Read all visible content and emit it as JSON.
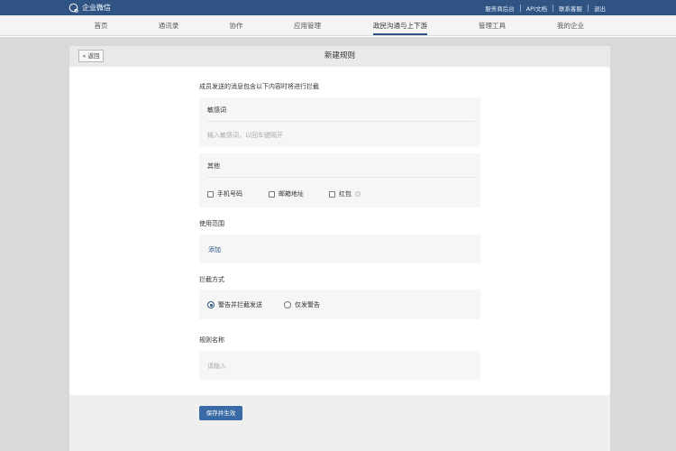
{
  "app": {
    "logo_text": "企业微信",
    "top_links": [
      "服务商后台",
      "API文档",
      "联系客服",
      "退出"
    ]
  },
  "nav": {
    "items": [
      "首页",
      "通讯录",
      "协作",
      "应用管理",
      "政民沟通与上下游",
      "管理工具",
      "我的企业"
    ],
    "active_index": 4
  },
  "page": {
    "back_label": "« 返回",
    "title": "新建规则"
  },
  "form": {
    "intro": "成员发送的消息包含以下内容时将进行拦截",
    "sensitive": {
      "title": "敏感词",
      "placeholder": "输入敏感词，以回车键隔开"
    },
    "other": {
      "title": "其他",
      "options": [
        "手机号码",
        "邮箱地址",
        "红包"
      ]
    },
    "scope": {
      "label": "使用范围",
      "add_label": "添加"
    },
    "intercept": {
      "label": "拦截方式",
      "options": [
        "警告并拦截发送",
        "仅发警告"
      ],
      "selected_index": 0
    },
    "rule_name": {
      "label": "规则名称",
      "placeholder": "请输入"
    },
    "save_label": "保存并生效"
  },
  "colors": {
    "accent": "#2f5484",
    "button": "#3a6aa5",
    "panel_bg": "#f6f6f6"
  }
}
